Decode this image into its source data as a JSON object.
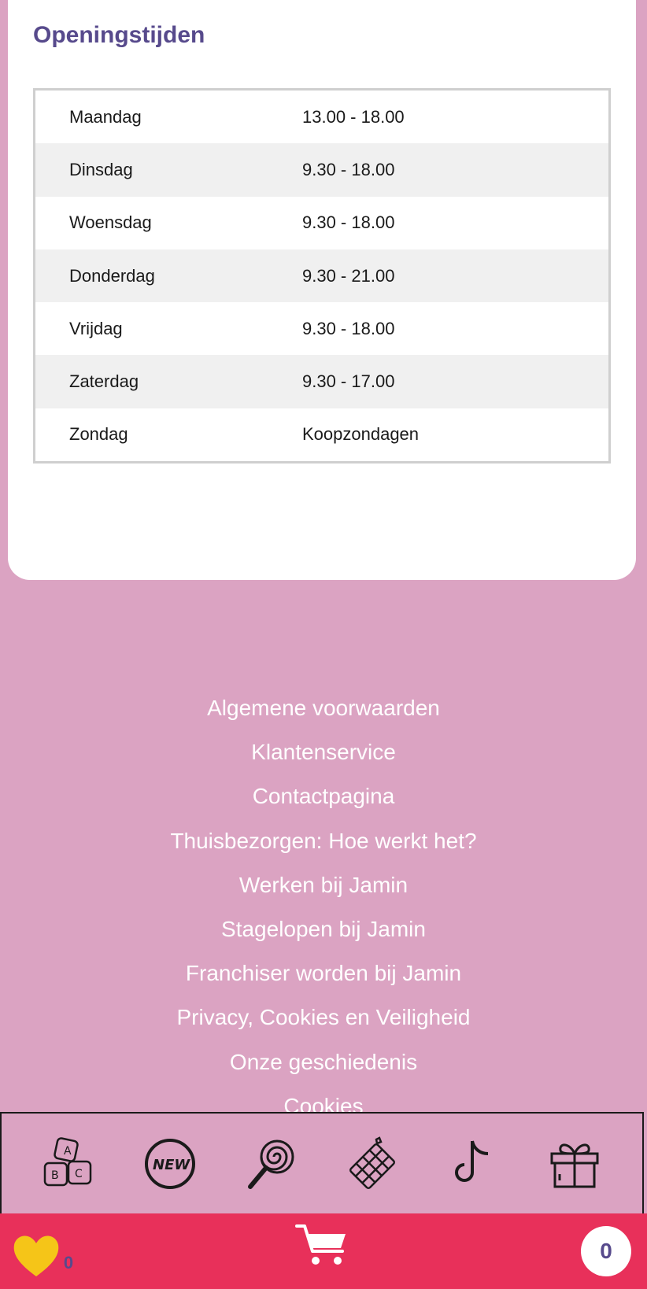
{
  "section": {
    "title": "Openingstijden"
  },
  "hours": [
    {
      "day": "Maandag",
      "time": "13.00 - 18.00"
    },
    {
      "day": "Dinsdag",
      "time": "9.30 - 18.00"
    },
    {
      "day": "Woensdag",
      "time": "9.30 - 18.00"
    },
    {
      "day": "Donderdag",
      "time": "9.30 - 21.00"
    },
    {
      "day": "Vrijdag",
      "time": "9.30 - 18.00"
    },
    {
      "day": "Zaterdag",
      "time": "9.30 - 17.00"
    },
    {
      "day": "Zondag",
      "time": "Koopzondagen"
    }
  ],
  "footer": {
    "links": [
      "Algemene voorwaarden",
      "Klantenservice",
      "Contactpagina",
      "Thuisbezorgen: Hoe werkt het?",
      "Werken bij Jamin",
      "Stagelopen bij Jamin",
      "Franchiser worden bij Jamin",
      "Privacy, Cookies en Veiligheid",
      "Onze geschiedenis",
      "Cookies"
    ]
  },
  "category_bar": {
    "icons": [
      "abc-blocks-icon",
      "new-badge-icon",
      "lollipop-icon",
      "chocolate-icon",
      "tiktok-icon",
      "gift-icon"
    ]
  },
  "bottom_bar": {
    "favorites_count": "0",
    "cart_count": "0",
    "colors": {
      "bar": "#e8305a",
      "heart": "#f5c518",
      "accent": "#574a8c"
    }
  }
}
